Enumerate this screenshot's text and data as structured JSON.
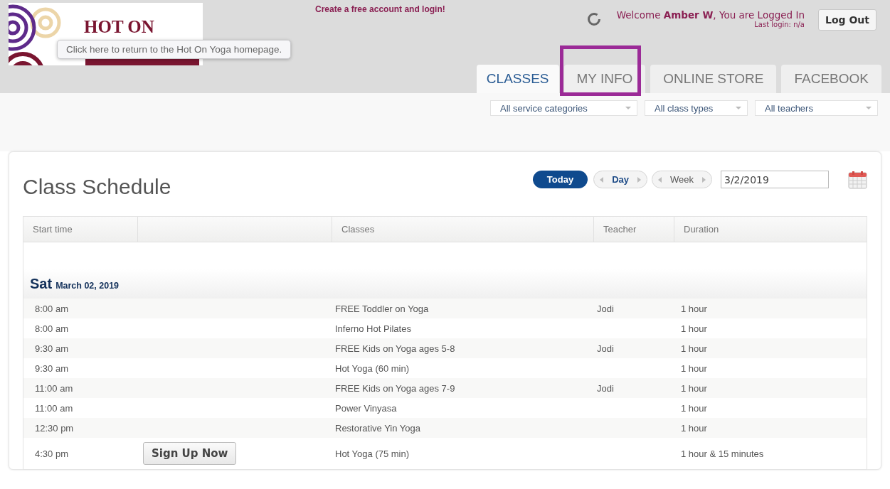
{
  "header": {
    "logo_text": "HOT ON",
    "tooltip": "Click here to return to the Hot On Yoga homepage.",
    "signup_link": "Create a free account and login!",
    "welcome_prefix": "Welcome ",
    "user_name": "Amber W",
    "welcome_suffix": ", You are Logged In",
    "last_login": "Last login: n/a",
    "logout_button": "Log Out"
  },
  "tabs": [
    {
      "label": "CLASSES",
      "selected": true,
      "highlighted": false
    },
    {
      "label": "MY INFO",
      "selected": false,
      "highlighted": true
    },
    {
      "label": "ONLINE STORE",
      "selected": false,
      "highlighted": false
    },
    {
      "label": "FACEBOOK",
      "selected": false,
      "highlighted": false
    }
  ],
  "filters": [
    "All service categories",
    "All class types",
    "All teachers"
  ],
  "schedule": {
    "title": "Class Schedule",
    "today_button": "Today",
    "nav": [
      {
        "label": "Day",
        "selected": true
      },
      {
        "label": "Week",
        "selected": false
      }
    ],
    "date": "3/2/2019"
  },
  "table": {
    "columns": [
      "Start time",
      "",
      "Classes",
      "Teacher",
      "Duration"
    ],
    "day": {
      "weekday": "Sat",
      "date": "March 02, 2019"
    },
    "rows": [
      {
        "time": "8:00 am",
        "class": "FREE Toddler on Yoga",
        "teacher": "Jodi",
        "duration": "1 hour"
      },
      {
        "time": "8:00 am",
        "class": "Inferno Hot Pilates",
        "teacher": "",
        "duration": "1 hour"
      },
      {
        "time": "9:30 am",
        "class": "FREE Kids on Yoga ages 5-8",
        "teacher": "Jodi",
        "duration": "1 hour"
      },
      {
        "time": "9:30 am",
        "class": "Hot Yoga (60 min)",
        "teacher": "",
        "duration": "1 hour"
      },
      {
        "time": "11:00 am",
        "class": "FREE Kids on Yoga ages 7-9",
        "teacher": "Jodi",
        "duration": "1 hour"
      },
      {
        "time": "11:00 am",
        "class": "Power Vinyasa",
        "teacher": "",
        "duration": "1 hour"
      },
      {
        "time": "12:30 pm",
        "class": "Restorative Yin Yoga",
        "teacher": "",
        "duration": "1 hour"
      },
      {
        "time": "4:30 pm",
        "class": "Hot Yoga (75 min)",
        "teacher": "",
        "duration": "1 hour & 15 minutes",
        "action": "Sign Up Now"
      }
    ]
  }
}
